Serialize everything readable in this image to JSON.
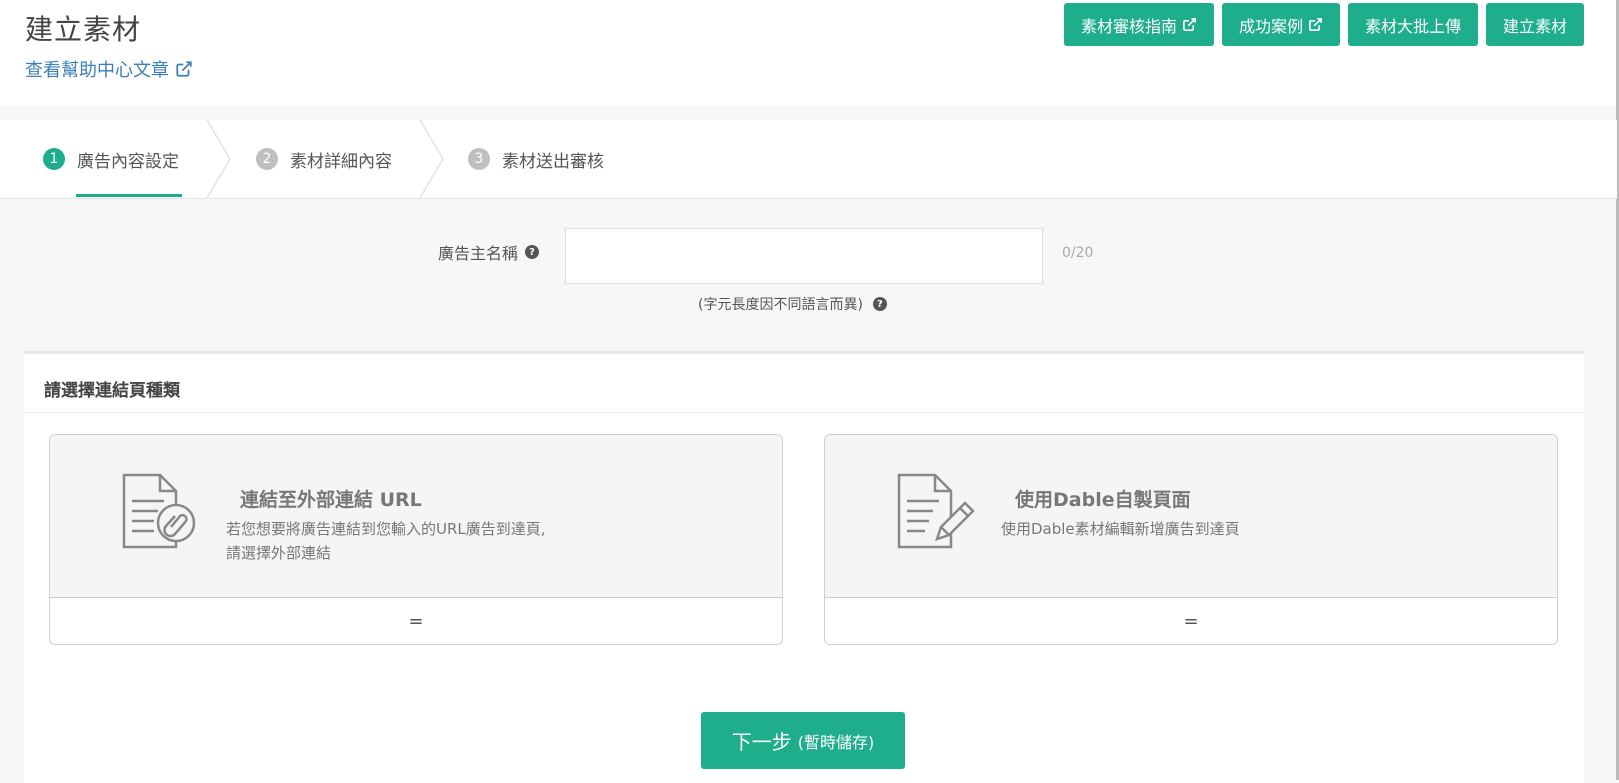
{
  "header": {
    "title": "建立素材",
    "help_link": "查看幫助中心文章",
    "buttons": [
      {
        "label": "素材審核指南",
        "external": true
      },
      {
        "label": "成功案例",
        "external": true
      },
      {
        "label": "素材大批上傳",
        "external": false
      },
      {
        "label": "建立素材",
        "external": false
      }
    ]
  },
  "steps": [
    {
      "num": "1",
      "label": "廣告內容設定",
      "active": true
    },
    {
      "num": "2",
      "label": "素材詳細內容",
      "active": false
    },
    {
      "num": "3",
      "label": "素材送出審核",
      "active": false
    }
  ],
  "advertiser": {
    "label": "廣告主名稱",
    "value": "",
    "counter": "0/20",
    "hint": "(字元長度因不同語言而異)"
  },
  "link_type": {
    "section_title": "請選擇連結頁種類",
    "options": [
      {
        "title": "連結至外部連結 URL",
        "desc_line1": "若您想要將廣告連結到您輸入的URL廣告到達頁,",
        "desc_line2": "請選擇外部連結",
        "footer": "=",
        "icon": "document-link-icon"
      },
      {
        "title": "使用Dable自製頁面",
        "desc_line1": "使用Dable素材編輯新增廣告到達頁",
        "desc_line2": "",
        "footer": "=",
        "icon": "document-edit-icon"
      }
    ]
  },
  "next_button": {
    "label": "下一步",
    "sub_label": "(暫時儲存)"
  },
  "colors": {
    "accent": "#1fae8c",
    "link": "#3d7fb8"
  }
}
